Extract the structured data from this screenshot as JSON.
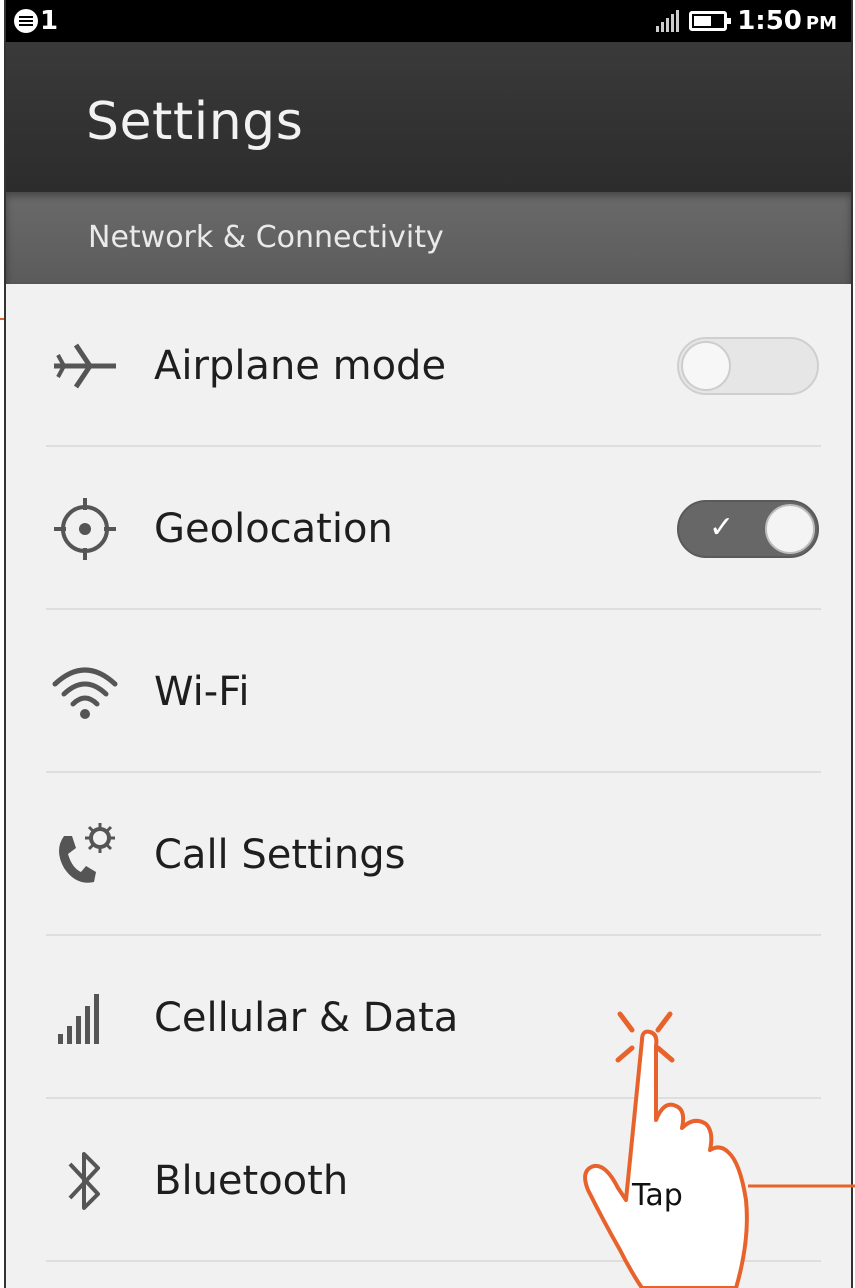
{
  "status_bar": {
    "notification_count": "1",
    "time": "1:50",
    "ampm": "PM",
    "icons": [
      "notification-badge-icon",
      "signal-icon",
      "battery-icon"
    ]
  },
  "header": {
    "title": "Settings"
  },
  "section": {
    "title": "Network & Connectivity"
  },
  "items": [
    {
      "label": "Airplane mode",
      "icon": "airplane-icon",
      "toggle": "off"
    },
    {
      "label": "Geolocation",
      "icon": "geolocation-icon",
      "toggle": "on"
    },
    {
      "label": "Wi-Fi",
      "icon": "wifi-icon"
    },
    {
      "label": "Call Settings",
      "icon": "call-settings-icon"
    },
    {
      "label": "Cellular & Data",
      "icon": "cellular-icon"
    },
    {
      "label": "Bluetooth",
      "icon": "bluetooth-icon"
    }
  ],
  "annotation": {
    "label": "Tap",
    "gesture_icon": "tap-hand-icon",
    "accent_color": "#e8622c"
  }
}
